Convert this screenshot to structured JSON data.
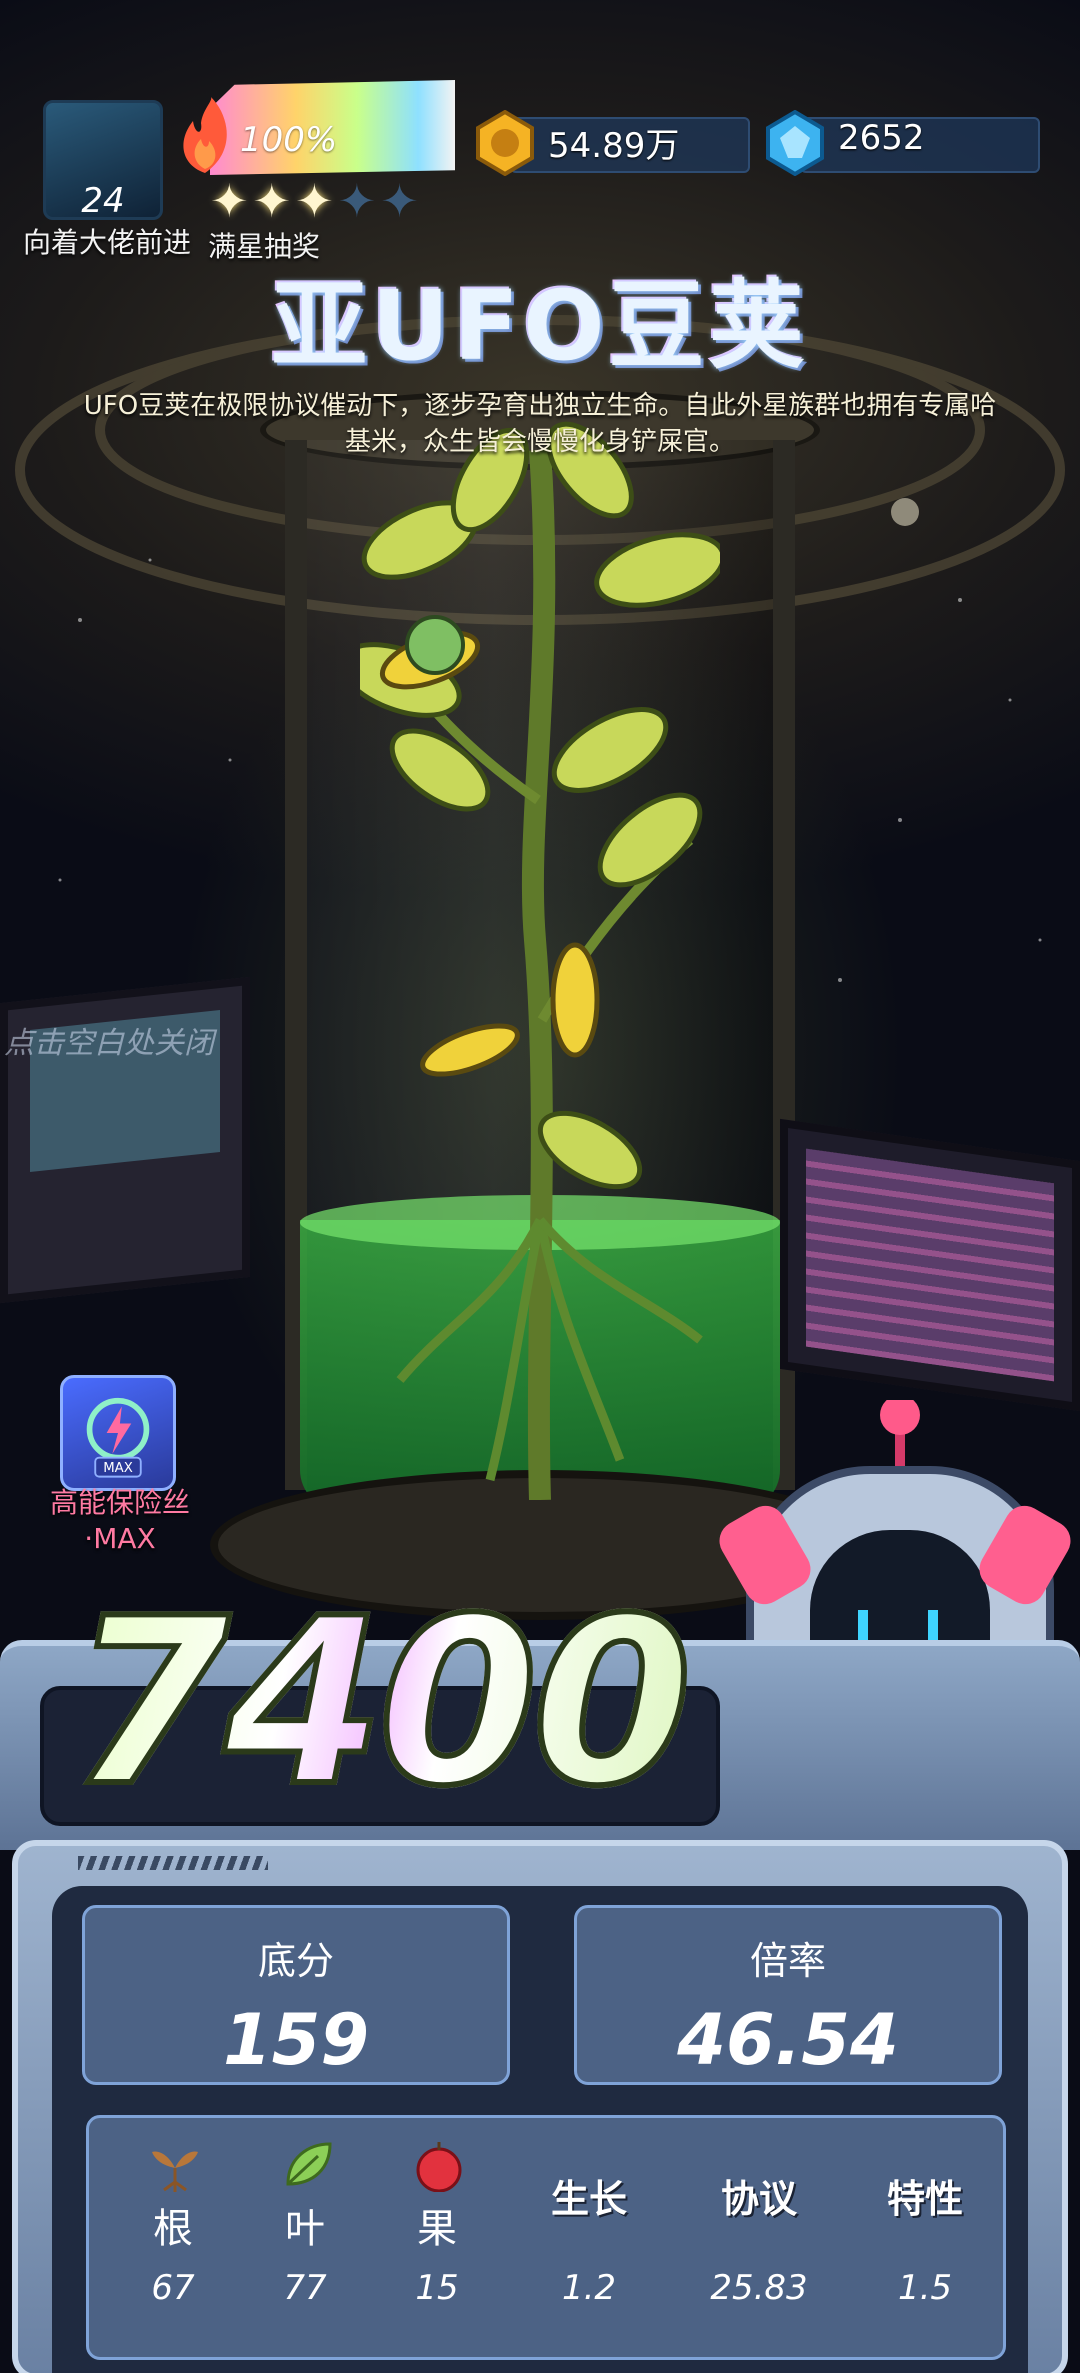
{
  "player": {
    "level": "24",
    "name": "向着大佬前进"
  },
  "energy": {
    "percent_label": "100%",
    "percent": 1.0,
    "stars_total": 5,
    "stars_filled": 3,
    "lottery_label": "满星抽奖"
  },
  "currency": {
    "coins": "54.89万",
    "gems": "2652"
  },
  "item": {
    "title": "亚UFO豆荚",
    "description": "UFO豆荚在极限协议催动下，逐步孕育出独立生命。自此外星族群也拥有专属哈基米，众生皆会慢慢化身铲屎官。"
  },
  "hint": "点击空白处关闭",
  "buff": {
    "name": "高能保险丝·MAX",
    "badge": "MAX"
  },
  "score": {
    "total": "7400",
    "base_label": "底分",
    "base_value": "159",
    "multiplier_label": "倍率",
    "multiplier_value": "46.54"
  },
  "stats": [
    {
      "label": "根",
      "value": "67",
      "icon": "sprout-icon"
    },
    {
      "label": "叶",
      "value": "77",
      "icon": "leaf-icon"
    },
    {
      "label": "果",
      "value": "15",
      "icon": "apple-icon"
    },
    {
      "label": "生长",
      "value": "1.2"
    },
    {
      "label": "协议",
      "value": "25.83"
    },
    {
      "label": "特性",
      "value": "1.5"
    }
  ],
  "colors": {
    "accent_pink": "#ff7aa2",
    "panel": "#4c6285",
    "liquid": "#3cbe46"
  }
}
